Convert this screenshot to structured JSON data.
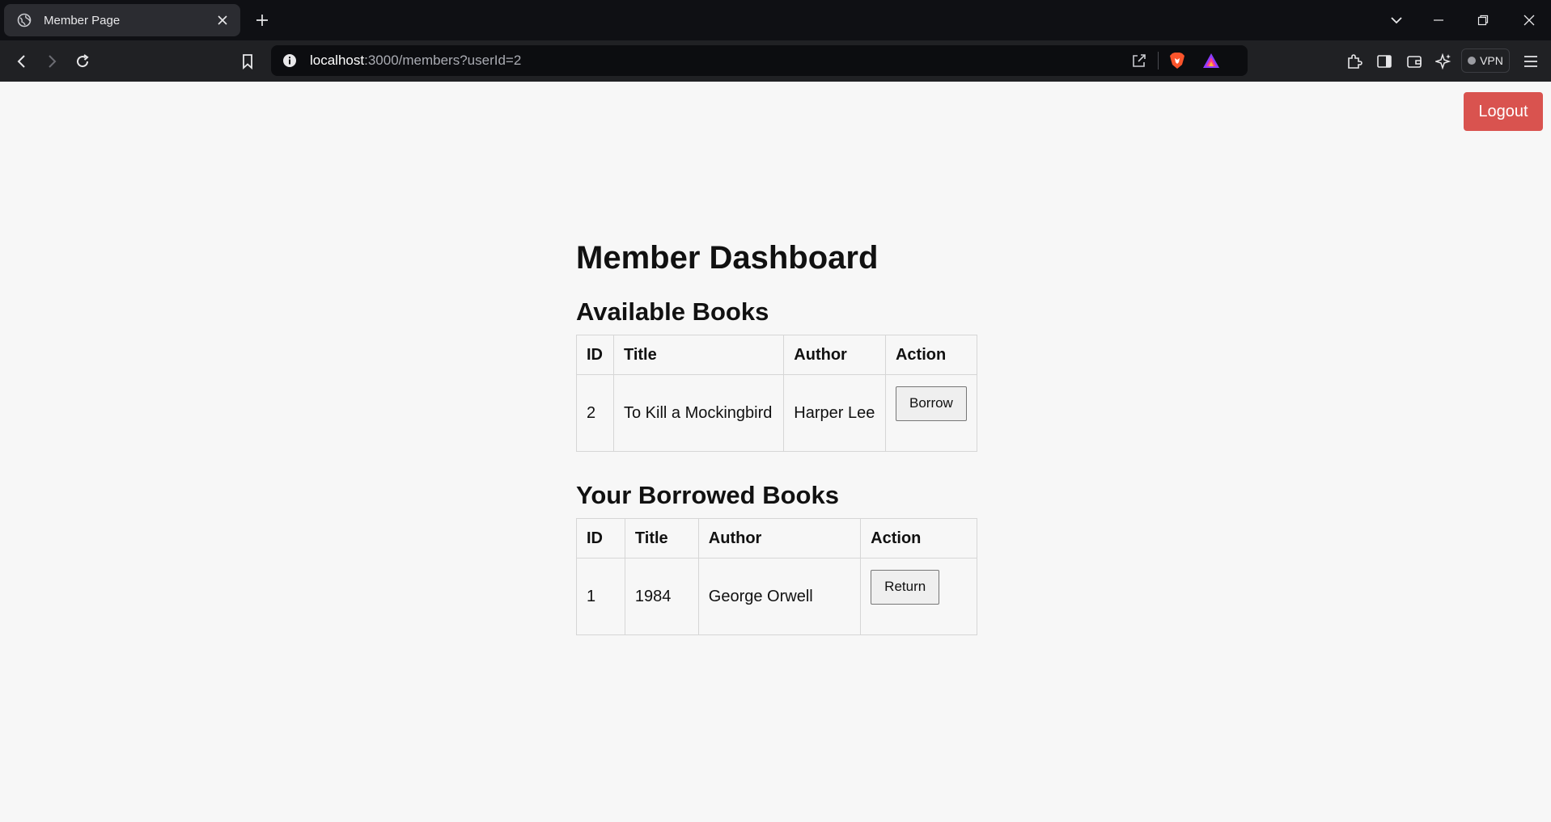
{
  "browser": {
    "tab_title": "Member Page",
    "url_host": "localhost",
    "url_path": ":3000/members?userId=2",
    "vpn_label": "VPN"
  },
  "header": {
    "logout_label": "Logout"
  },
  "main": {
    "title": "Member Dashboard",
    "available": {
      "heading": "Available Books",
      "columns": [
        "ID",
        "Title",
        "Author",
        "Action"
      ],
      "rows": [
        {
          "id": "2",
          "title": "To Kill a Mockingbird",
          "author": "Harper Lee",
          "action": "Borrow"
        }
      ]
    },
    "borrowed": {
      "heading": "Your Borrowed Books",
      "columns": [
        "ID",
        "Title",
        "Author",
        "Action"
      ],
      "rows": [
        {
          "id": "1",
          "title": "1984",
          "author": "George Orwell",
          "action": "Return"
        }
      ]
    }
  },
  "colors": {
    "logout_button": "#d9534f",
    "page_background": "#f7f7f7",
    "tab_strip": "#0f1014",
    "toolbar": "#202124"
  },
  "icons": [
    "globe-icon",
    "close-icon",
    "plus-icon",
    "chevron-down-icon",
    "minimize-icon",
    "restore-icon",
    "window-close-icon",
    "back-icon",
    "forward-icon",
    "reload-icon",
    "bookmark-icon",
    "info-icon",
    "share-icon",
    "brave-shield-icon",
    "brave-rewards-icon",
    "extensions-icon",
    "sidebar-icon",
    "wallet-icon",
    "leo-ai-icon",
    "menu-icon"
  ]
}
